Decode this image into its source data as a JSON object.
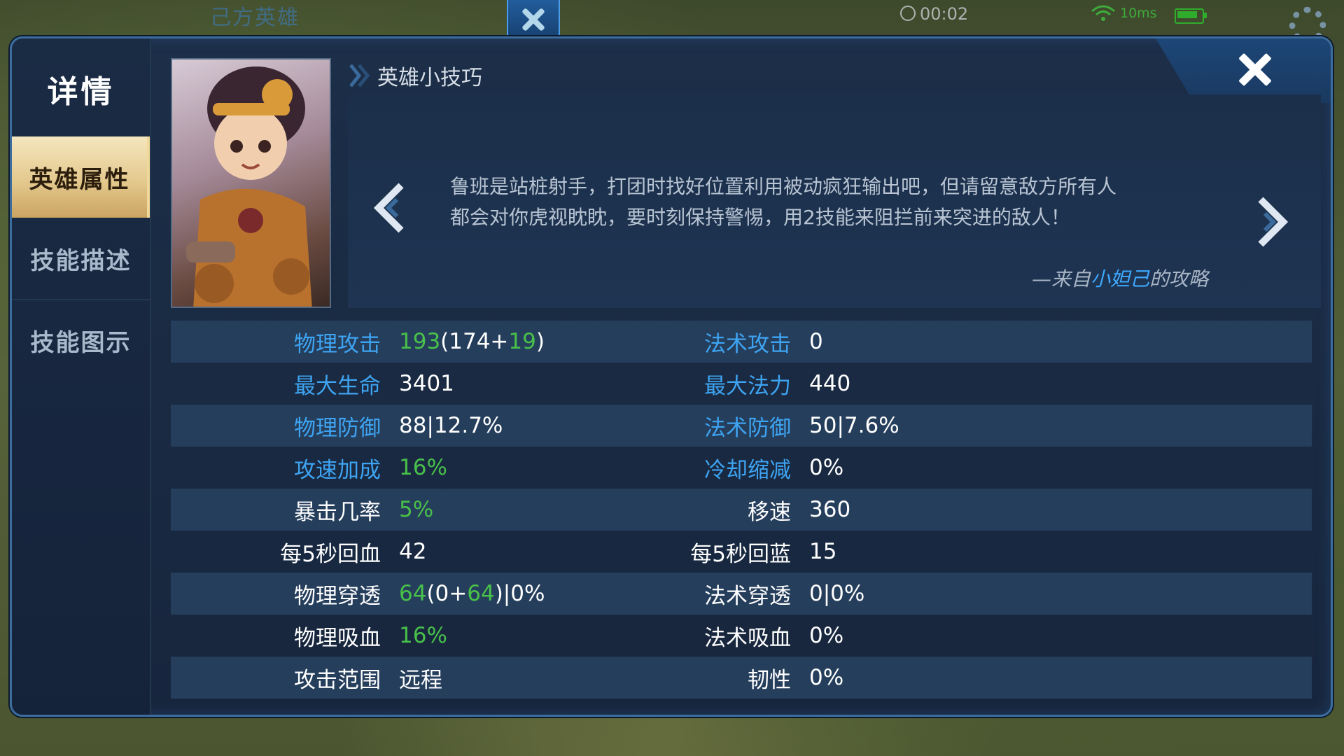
{
  "hud": {
    "team_label": "己方英雄",
    "timer": "00:02",
    "ping": "10ms"
  },
  "sidebar": {
    "title": "详情",
    "tabs": [
      {
        "label": "英雄属性",
        "active": true
      },
      {
        "label": "技能描述",
        "active": false
      },
      {
        "label": "技能图示",
        "active": false
      }
    ]
  },
  "tips": {
    "title": "英雄小技巧",
    "text_line1": "鲁班是站桩射手，打团时找好位置利用被动疯狂输出吧，但请留意敌方所有人",
    "text_line2": "都会对你虎视眈眈，要时刻保持警惕，用2技能来阻拦前来突进的敌人！",
    "source_prefix": "—来自",
    "source_author": "小妲己",
    "source_suffix": "的攻略"
  },
  "colors": {
    "label_blue": "#3ea4f2",
    "value_green": "#48c04a",
    "active_tab_gold": "#e4c98e",
    "panel_bg": "#1c2e48"
  },
  "stats": {
    "rows": [
      {
        "l_label": "物理攻击",
        "l_v1": "193",
        "l_v2": "(174+",
        "l_v3": "19",
        "l_v4": ")",
        "r_label": "法术攻击",
        "r_value": "0"
      },
      {
        "l_label": "最大生命",
        "l_value": "3401",
        "r_label": "最大法力",
        "r_value": "440"
      },
      {
        "l_label": "物理防御",
        "l_value": "88|12.7%",
        "r_label": "法术防御",
        "r_value": "50|7.6%"
      },
      {
        "l_label": "攻速加成",
        "l_value": "16%",
        "r_label": "冷却缩减",
        "r_value": "0%"
      },
      {
        "l_label": "暴击几率",
        "l_value": "5%",
        "r_label": "移速",
        "r_value": "360"
      },
      {
        "l_label": "每5秒回血",
        "l_value": "42",
        "r_label": "每5秒回蓝",
        "r_value": "15"
      },
      {
        "l_label": "物理穿透",
        "l_v1": "64",
        "l_v2": "(0+",
        "l_v3": "64",
        "l_v4": ")|0%",
        "r_label": "法术穿透",
        "r_value": "0|0%"
      },
      {
        "l_label": "物理吸血",
        "l_value": "16%",
        "r_label": "法术吸血",
        "r_value": "0%"
      },
      {
        "l_label": "攻击范围",
        "l_value": "远程",
        "r_label": "韧性",
        "r_value": "0%"
      }
    ]
  }
}
